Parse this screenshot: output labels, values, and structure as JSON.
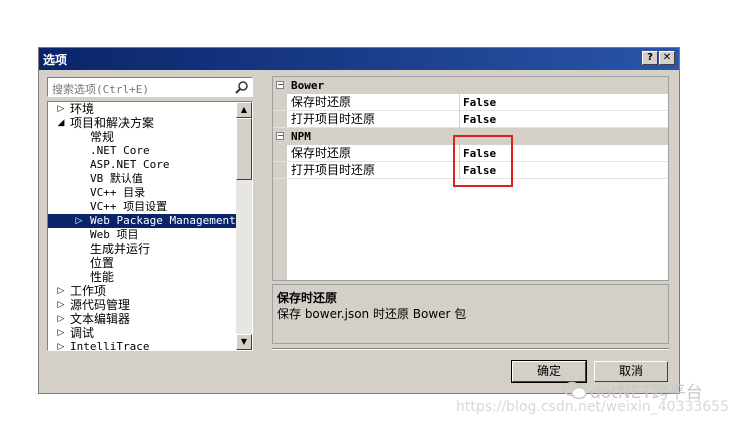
{
  "window": {
    "title": "选项",
    "help_label": "?",
    "close_label": "✕"
  },
  "search": {
    "placeholder": "搜索选项(Ctrl+E)",
    "icon": "search-icon"
  },
  "tree": {
    "items": [
      {
        "label": "环境",
        "level": 0,
        "expander": "▷"
      },
      {
        "label": "项目和解决方案",
        "level": 0,
        "expander": "◢"
      },
      {
        "label": "常规",
        "level": 1,
        "expander": ""
      },
      {
        "label": ".NET Core",
        "level": 1,
        "expander": ""
      },
      {
        "label": "ASP.NET Core",
        "level": 1,
        "expander": ""
      },
      {
        "label": "VB 默认值",
        "level": 1,
        "expander": ""
      },
      {
        "label": "VC++ 目录",
        "level": 1,
        "expander": ""
      },
      {
        "label": "VC++ 项目设置",
        "level": 1,
        "expander": ""
      },
      {
        "label": "Web Package Management",
        "level": 1,
        "expander": "▷",
        "selected": true
      },
      {
        "label": "Web 项目",
        "level": 1,
        "expander": ""
      },
      {
        "label": "生成并运行",
        "level": 1,
        "expander": ""
      },
      {
        "label": "位置",
        "level": 1,
        "expander": ""
      },
      {
        "label": "性能",
        "level": 1,
        "expander": ""
      },
      {
        "label": "工作项",
        "level": 0,
        "expander": "▷"
      },
      {
        "label": "源代码管理",
        "level": 0,
        "expander": "▷"
      },
      {
        "label": "文本编辑器",
        "level": 0,
        "expander": "▷"
      },
      {
        "label": "调试",
        "level": 0,
        "expander": "▷"
      },
      {
        "label": "IntelliTrace",
        "level": 0,
        "expander": "▷"
      }
    ]
  },
  "grid": {
    "categories": [
      {
        "name": "Bower",
        "toggle": "⊟",
        "props": [
          {
            "name": "保存时还原",
            "value": "False"
          },
          {
            "name": "打开项目时还原",
            "value": "False"
          }
        ]
      },
      {
        "name": "NPM",
        "toggle": "⊟",
        "props": [
          {
            "name": "保存时还原",
            "value": "False"
          },
          {
            "name": "打开项目时还原",
            "value": "False"
          }
        ]
      }
    ]
  },
  "description": {
    "title": "保存时还原",
    "text": "保存 bower.json 时还原 Bower 包"
  },
  "buttons": {
    "ok": "确定",
    "cancel": "取消"
  },
  "watermark": {
    "brand": "dotNET跨平台",
    "url": "https://blog.csdn.net/weixin_40333655"
  },
  "colors": {
    "titlebar": "#0a246a",
    "selection": "#0a246a",
    "highlight_box": "#e02020"
  }
}
